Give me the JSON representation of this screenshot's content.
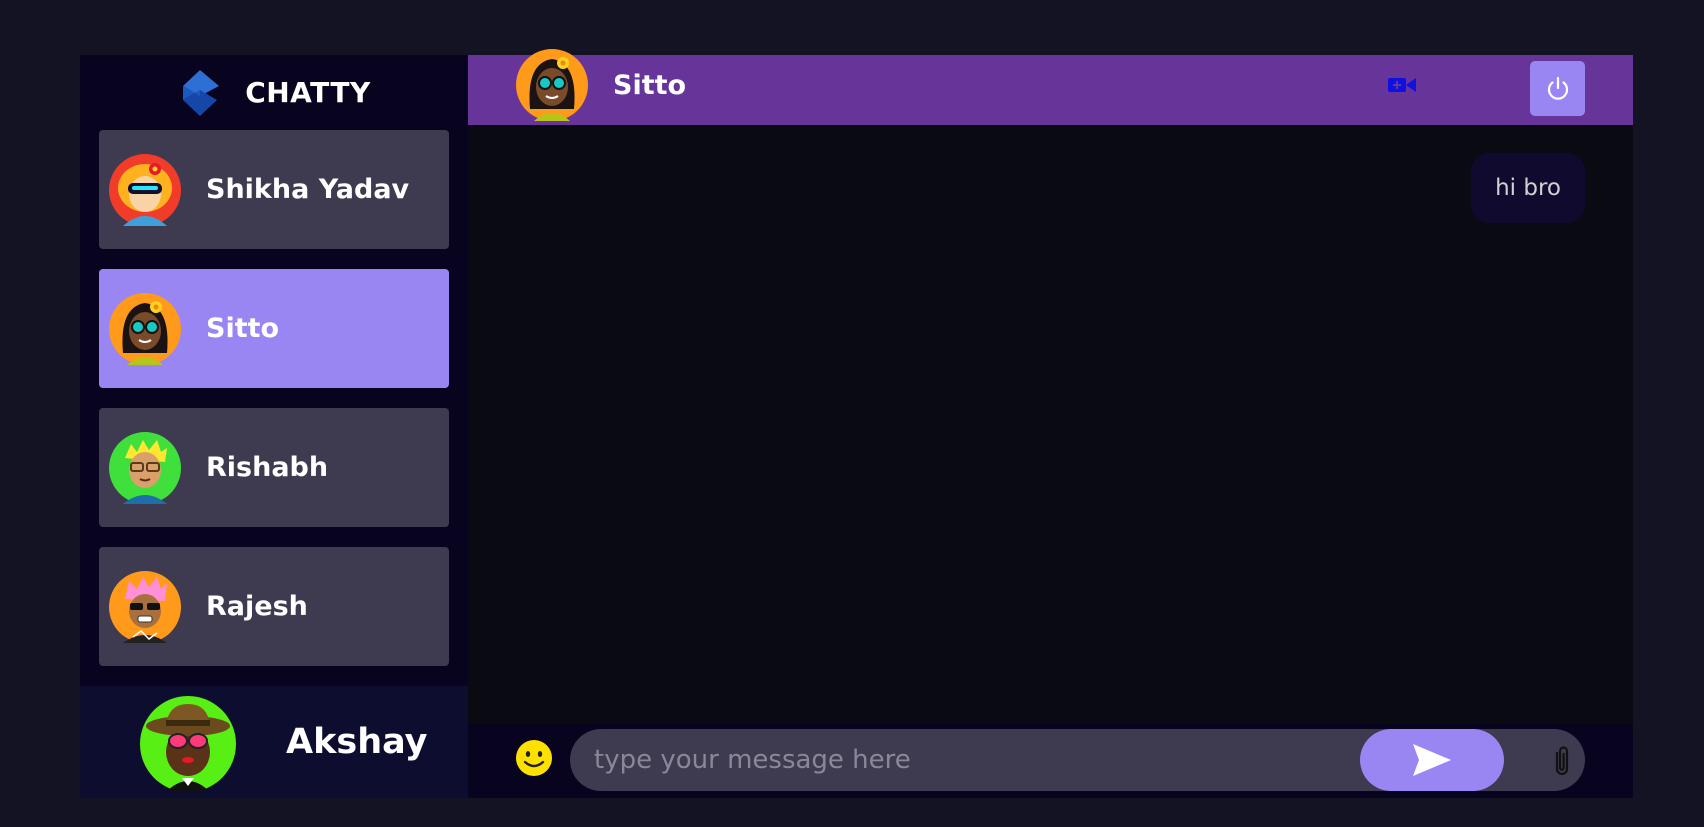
{
  "brand": {
    "title": "CHATTY",
    "logo_icon": "chatty-logo-icon"
  },
  "contacts": [
    {
      "name": "Shikha Yadav",
      "avatar": "avatar-red-hair-visor",
      "selected": false
    },
    {
      "name": "Sitto",
      "avatar": "avatar-dark-hair-flower-sunglasses",
      "selected": true
    },
    {
      "name": "Rishabh",
      "avatar": "avatar-blond-glasses",
      "selected": false
    },
    {
      "name": "Rajesh",
      "avatar": "avatar-pink-hair-sunglasses",
      "selected": false
    }
  ],
  "current_user": {
    "name": "Akshay",
    "avatar": "avatar-hat-sunglasses"
  },
  "chat": {
    "header": {
      "name": "Sitto",
      "video_icon": "video-call-icon",
      "logout_icon": "power-icon"
    },
    "messages": [
      {
        "text": "hi bro",
        "sent": true
      }
    ],
    "input": {
      "placeholder": "type your message here",
      "value": ""
    },
    "icons": {
      "emoji": "emoji-icon",
      "send": "send-icon",
      "attach": "paperclip-icon"
    }
  },
  "colors": {
    "page_bg": "#131324",
    "sidebar_bg": "#080420",
    "contact_bg": "#3e3a50",
    "selected_bg": "#9a86f3",
    "header_bg": "#67359a",
    "chat_bg": "#0a0a13",
    "bubble_bg": "#100b2e",
    "accent": "#9a86f3"
  }
}
